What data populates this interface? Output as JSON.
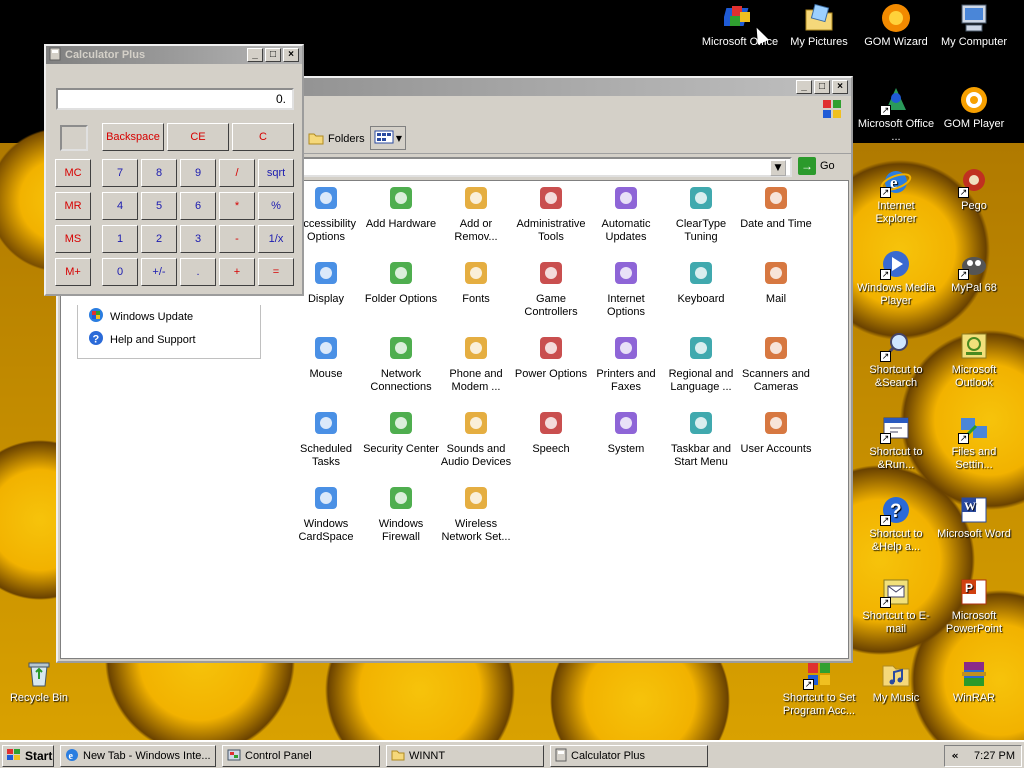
{
  "desktop": {
    "icons": [
      {
        "label": "Microsoft Office",
        "icon": "office-icon"
      },
      {
        "label": "My Pictures",
        "icon": "folder-pictures-icon"
      },
      {
        "label": "GOM Wizard",
        "icon": "gom-wizard-icon"
      },
      {
        "label": "My Computer",
        "icon": "computer-icon"
      },
      {
        "label": "Microsoft Office ...",
        "icon": "office-shortcut-icon"
      },
      {
        "label": "GOM Player",
        "icon": "gom-player-icon"
      },
      {
        "label": "Internet Explorer",
        "icon": "ie-icon"
      },
      {
        "label": "Pego",
        "icon": "pego-icon"
      },
      {
        "label": "Windows Media Player",
        "icon": "media-player-icon"
      },
      {
        "label": "MyPal 68",
        "icon": "mypal-icon"
      },
      {
        "label": "Shortcut to &Search",
        "icon": "search-shortcut-icon"
      },
      {
        "label": "Microsoft Outlook",
        "icon": "outlook-icon"
      },
      {
        "label": "Shortcut to &Run...",
        "icon": "run-shortcut-icon"
      },
      {
        "label": "Files and Settin...",
        "icon": "files-settings-icon"
      },
      {
        "label": "Shortcut to &Help a...",
        "icon": "help-shortcut-icon"
      },
      {
        "label": "Microsoft Word",
        "icon": "word-icon"
      },
      {
        "label": "Shortcut to E-mail",
        "icon": "email-shortcut-icon"
      },
      {
        "label": "Microsoft PowerPoint",
        "icon": "powerpoint-icon"
      },
      {
        "label": "Recycle Bin",
        "icon": "recycle-bin-icon"
      },
      {
        "label": "Shortcut to Set Program Acc...",
        "icon": "program-access-icon"
      },
      {
        "label": "My Music",
        "icon": "music-folder-icon"
      },
      {
        "label": "WinRAR",
        "icon": "winrar-icon"
      }
    ]
  },
  "control_panel": {
    "folders_label": "Folders",
    "go_label": "Go",
    "side_links": [
      {
        "label": "Windows Update",
        "icon": "windows-update-icon"
      },
      {
        "label": "Help and Support",
        "icon": "help-icon"
      }
    ],
    "items": [
      {
        "label": "Accessibility Options",
        "icon": "accessibility-icon"
      },
      {
        "label": "Add Hardware",
        "icon": "add-hardware-icon"
      },
      {
        "label": "Add or Remov...",
        "icon": "add-remove-icon"
      },
      {
        "label": "Administrative Tools",
        "icon": "admin-tools-icon"
      },
      {
        "label": "Automatic Updates",
        "icon": "auto-updates-icon"
      },
      {
        "label": "ClearType Tuning",
        "icon": "cleartype-icon"
      },
      {
        "label": "Date and Time",
        "icon": "date-time-icon"
      },
      {
        "label": "Display",
        "icon": "display-icon"
      },
      {
        "label": "Folder Options",
        "icon": "folder-options-icon"
      },
      {
        "label": "Fonts",
        "icon": "fonts-icon"
      },
      {
        "label": "Game Controllers",
        "icon": "game-controllers-icon"
      },
      {
        "label": "Internet Options",
        "icon": "internet-options-icon"
      },
      {
        "label": "Keyboard",
        "icon": "keyboard-icon"
      },
      {
        "label": "Mail",
        "icon": "mail-icon"
      },
      {
        "label": "Mouse",
        "icon": "mouse-icon"
      },
      {
        "label": "Network Connections",
        "icon": "network-icon"
      },
      {
        "label": "Phone and Modem ...",
        "icon": "phone-modem-icon"
      },
      {
        "label": "Power Options",
        "icon": "power-icon"
      },
      {
        "label": "Printers and Faxes",
        "icon": "printers-icon"
      },
      {
        "label": "Regional and Language ...",
        "icon": "regional-icon"
      },
      {
        "label": "Scanners and Cameras",
        "icon": "scanners-icon"
      },
      {
        "label": "Scheduled Tasks",
        "icon": "scheduled-tasks-icon"
      },
      {
        "label": "Security Center",
        "icon": "security-center-icon"
      },
      {
        "label": "Sounds and Audio Devices",
        "icon": "sounds-icon"
      },
      {
        "label": "Speech",
        "icon": "speech-icon"
      },
      {
        "label": "System",
        "icon": "system-icon"
      },
      {
        "label": "Taskbar and Start Menu",
        "icon": "taskbar-icon"
      },
      {
        "label": "User Accounts",
        "icon": "user-accounts-icon"
      },
      {
        "label": "Windows CardSpace",
        "icon": "cardspace-icon"
      },
      {
        "label": "Windows Firewall",
        "icon": "firewall-icon"
      },
      {
        "label": "Wireless Network Set...",
        "icon": "wireless-icon"
      }
    ]
  },
  "calculator": {
    "title": "Calculator Plus",
    "display": "0.",
    "buttons": {
      "backspace": "Backspace",
      "ce": "CE",
      "c": "C",
      "mc": "MC",
      "mr": "MR",
      "ms": "MS",
      "mplus": "M+",
      "n7": "7",
      "n8": "8",
      "n9": "9",
      "div": "/",
      "sqrt": "sqrt",
      "n4": "4",
      "n5": "5",
      "n6": "6",
      "mul": "*",
      "pct": "%",
      "n1": "1",
      "n2": "2",
      "n3": "3",
      "sub": "-",
      "inv": "1/x",
      "n0": "0",
      "sign": "+/-",
      "dot": ".",
      "add": "+",
      "eq": "="
    }
  },
  "taskbar": {
    "start": "Start",
    "tasks": [
      {
        "label": "New Tab - Windows Inte...",
        "icon": "ie-icon"
      },
      {
        "label": "Control Panel",
        "icon": "control-panel-icon"
      },
      {
        "label": "WINNT",
        "icon": "folder-icon"
      },
      {
        "label": "Calculator Plus",
        "icon": "calculator-icon"
      }
    ],
    "tray_chevron": "«",
    "clock": "7:27 PM"
  },
  "colors": {
    "calc_red": "#d60000",
    "calc_blue": "#1b1bb0",
    "title_active": "#0a246a",
    "title_inactive": "#808080"
  }
}
